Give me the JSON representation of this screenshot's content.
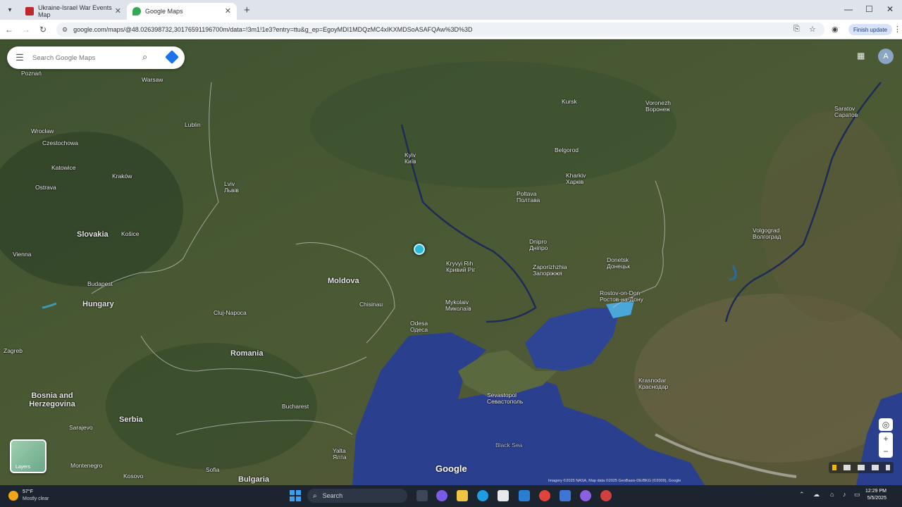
{
  "browser": {
    "tabs": [
      {
        "title": "Ukraine-Israel War Events Map",
        "active": false,
        "favicon_color": "#c0272d"
      },
      {
        "title": "Google Maps",
        "active": true,
        "favicon_color": "#34a853"
      }
    ],
    "new_tab": "+",
    "url": "google.com/maps/@48.026398732,30176591196700m/data=!3m1!1e3?entry=ttu&g_ep=EgoyMDI1MDQzMC4xIKXMDSoASAFQAw%3D%3D",
    "update_label": "Finish update",
    "window_controls": [
      "—",
      "☐",
      "✕"
    ]
  },
  "maps": {
    "search_placeholder": "Search Google Maps",
    "layers_label": "Layers",
    "avatar_initial": "A",
    "logo": "Google",
    "attribution": "Imagery ©2025 NASA, Map data ©2025 GeoBasis-DE/BKG (©2009), Google",
    "marker_color": "#2db8d6"
  },
  "labels": {
    "countries": [
      {
        "name": "Slovakia"
      },
      {
        "name": "Hungary"
      },
      {
        "name": "Moldova"
      },
      {
        "name": "Romania"
      },
      {
        "name": "Bosnia and Herzegovina"
      },
      {
        "name": "Serbia"
      },
      {
        "name": "Bulgaria"
      }
    ],
    "cities": [
      {
        "name": "Kyiv",
        "local": "Київ"
      },
      {
        "name": "Kharkiv",
        "local": "Харків"
      },
      {
        "name": "Poltava",
        "local": "Полтава"
      },
      {
        "name": "Dnipro",
        "local": "Дніпро"
      },
      {
        "name": "Kryvyi Rih",
        "local": "Кривий Ріг"
      },
      {
        "name": "Zaporizhzhia",
        "local": "Запоріжжя"
      },
      {
        "name": "Donetsk",
        "local": "Донецьк"
      },
      {
        "name": "Mykolaiv",
        "local": "Миколаїв"
      },
      {
        "name": "Odesa",
        "local": "Одеса"
      },
      {
        "name": "Rostov-on-Don",
        "local": "Ростов-на-Дону"
      },
      {
        "name": "Sevastopol",
        "local": "Севастополь"
      },
      {
        "name": "Krasnodar",
        "local": "Краснодар"
      },
      {
        "name": "Voronezh",
        "local": "Воронеж"
      },
      {
        "name": "Saratov",
        "local": "Саратов"
      },
      {
        "name": "Volgograd",
        "local": "Волгоград"
      },
      {
        "name": "Yalta",
        "local": "Ялта"
      },
      {
        "name": "Lviv",
        "local": "Львів"
      },
      {
        "name": "Chisinau",
        "local": ""
      },
      {
        "name": "Warsaw",
        "local": ""
      },
      {
        "name": "Lublin",
        "local": ""
      },
      {
        "name": "Kraków",
        "local": ""
      },
      {
        "name": "Wrocław",
        "local": ""
      },
      {
        "name": "Budapest",
        "local": ""
      },
      {
        "name": "Bucharest",
        "local": ""
      },
      {
        "name": "Cluj-Napoca",
        "local": ""
      },
      {
        "name": "Zagreb",
        "local": ""
      },
      {
        "name": "Sarajevo",
        "local": ""
      },
      {
        "name": "Montenegro",
        "local": ""
      },
      {
        "name": "Sofia",
        "local": ""
      },
      {
        "name": "Kosovo",
        "local": ""
      },
      {
        "name": "Košice",
        "local": ""
      },
      {
        "name": "Ostrava",
        "local": ""
      },
      {
        "name": "Katowice",
        "local": ""
      },
      {
        "name": "Poznań",
        "local": ""
      },
      {
        "name": "Vienna",
        "local": ""
      },
      {
        "name": "Czestochowa",
        "local": ""
      },
      {
        "name": "Kursk",
        "local": ""
      },
      {
        "name": "Belgorod",
        "local": ""
      }
    ],
    "sea": "Black Sea"
  },
  "taskbar": {
    "weather_temp": "57°F",
    "weather_desc": "Mostly clear",
    "search_label": "Search",
    "time": "12:29 PM",
    "date": "5/5/2025"
  }
}
